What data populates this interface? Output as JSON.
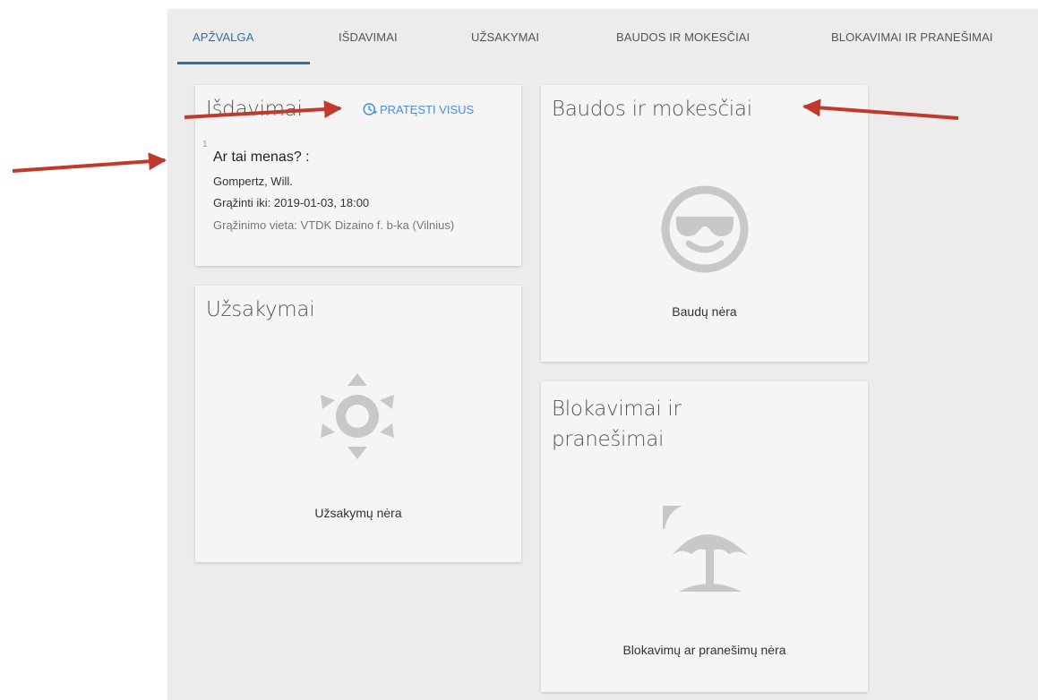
{
  "tabs": [
    {
      "label": "APŽVALGA",
      "active": true
    },
    {
      "label": "IŠDAVIMAI",
      "active": false
    },
    {
      "label": "UŽSAKYMAI",
      "active": false
    },
    {
      "label": "BAUDOS IR MOKESČIAI",
      "active": false
    },
    {
      "label": "BLOKAVIMAI IR PRANEŠIMAI",
      "active": false
    }
  ],
  "loans_card": {
    "title": "Išdavimai",
    "renew_all_label": "PRATĘSTI VISUS",
    "items": [
      {
        "index": "1",
        "title": "Ar tai menas? :",
        "author": "Gompertz, Will.",
        "due": "Grąžinti iki: 2019-01-03, 18:00",
        "return_location": "Grąžinimo vieta: VTDK Dizaino f. b-ka (Vilnius)"
      }
    ]
  },
  "requests_card": {
    "title": "Užsakymai",
    "icon": "sun-icon",
    "empty_text": "Užsakymų nėra"
  },
  "fines_card": {
    "title": "Baudos ir mokesčiai",
    "icon": "sunglasses-smiley-icon",
    "empty_text": "Baudų nėra"
  },
  "blocks_card": {
    "title_lines": [
      "Blokavimai ir",
      "pranešimai"
    ],
    "icon": "beach-umbrella-icon",
    "empty_text": "Blokavimų ar pranešimų nėra"
  },
  "colors": {
    "accent": "#2f6fa8",
    "link": "#4a8fd0",
    "annotation_arrow": "#c0392b",
    "icon_gray": "#c8c8c8"
  }
}
